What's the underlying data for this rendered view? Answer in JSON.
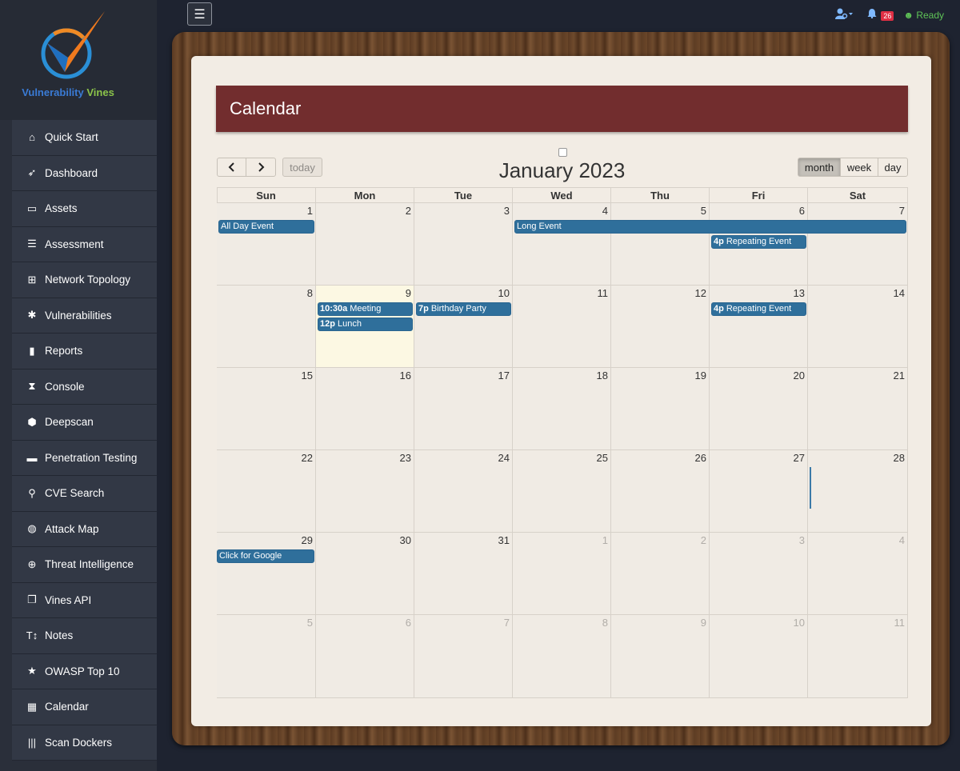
{
  "brand": {
    "name_part1": "Vulnerability",
    "name_part2": "Vines"
  },
  "sidebar": {
    "items": [
      {
        "label": "Quick Start",
        "icon": "home-icon",
        "glyph": "⌂"
      },
      {
        "label": "Dashboard",
        "icon": "rocket-icon",
        "glyph": "➶"
      },
      {
        "label": "Assets",
        "icon": "laptop-icon",
        "glyph": "▭"
      },
      {
        "label": "Assessment",
        "icon": "list-icon",
        "glyph": "☰"
      },
      {
        "label": "Network Topology",
        "icon": "sitemap-icon",
        "glyph": "⊞"
      },
      {
        "label": "Vulnerabilities",
        "icon": "bug-icon",
        "glyph": "✱"
      },
      {
        "label": "Reports",
        "icon": "file-icon",
        "glyph": "▮"
      },
      {
        "label": "Console",
        "icon": "hourglass-icon",
        "glyph": "⧗"
      },
      {
        "label": "Deepscan",
        "icon": "cube-icon",
        "glyph": "⬢"
      },
      {
        "label": "Penetration Testing",
        "icon": "hdd-icon",
        "glyph": "▬"
      },
      {
        "label": "CVE Search",
        "icon": "search-icon",
        "glyph": "⚲"
      },
      {
        "label": "Attack Map",
        "icon": "globe-icon",
        "glyph": "◍"
      },
      {
        "label": "Threat Intelligence",
        "icon": "crosshairs-icon",
        "glyph": "⊕"
      },
      {
        "label": "Vines API",
        "icon": "clone-icon",
        "glyph": "❐"
      },
      {
        "label": "Notes",
        "icon": "text-height-icon",
        "glyph": "T↕"
      },
      {
        "label": "OWASP Top 10",
        "icon": "star-icon",
        "glyph": "★"
      },
      {
        "label": "Calendar",
        "icon": "calendar-icon",
        "glyph": "▦"
      },
      {
        "label": "Scan Dockers",
        "icon": "barcode-icon",
        "glyph": "|||"
      }
    ]
  },
  "topbar": {
    "menu_icon": "☰",
    "notification_count": "26",
    "status": "Ready"
  },
  "page": {
    "title": "Calendar"
  },
  "calendar": {
    "title": "January 2023",
    "today_label": "today",
    "prev": "‹",
    "next": "›",
    "views": [
      "month",
      "week",
      "day"
    ],
    "active_view": "month",
    "weekdays": [
      "Sun",
      "Mon",
      "Tue",
      "Wed",
      "Thu",
      "Fri",
      "Sat"
    ],
    "weeks": [
      [
        "1",
        "2",
        "3",
        "4",
        "5",
        "6",
        "7"
      ],
      [
        "8",
        "9",
        "10",
        "11",
        "12",
        "13",
        "14"
      ],
      [
        "15",
        "16",
        "17",
        "18",
        "19",
        "20",
        "21"
      ],
      [
        "22",
        "23",
        "24",
        "25",
        "26",
        "27",
        "28"
      ],
      [
        "29",
        "30",
        "31",
        "1",
        "2",
        "3",
        "4"
      ],
      [
        "5",
        "6",
        "7",
        "8",
        "9",
        "10",
        "11"
      ]
    ],
    "today": {
      "week": 1,
      "day": 1
    },
    "events": [
      {
        "title": "All Day Event",
        "time": "",
        "week": 0,
        "day": 0,
        "span": 1,
        "slot": 0
      },
      {
        "title": "Long Event",
        "time": "",
        "week": 0,
        "day": 3,
        "span": 4,
        "slot": 0
      },
      {
        "title": "Repeating Event",
        "time": "4p",
        "week": 0,
        "day": 5,
        "span": 1,
        "slot": 1
      },
      {
        "title": "Meeting",
        "time": "10:30a",
        "week": 1,
        "day": 1,
        "span": 1,
        "slot": 0
      },
      {
        "title": "Lunch",
        "time": "12p",
        "week": 1,
        "day": 1,
        "span": 1,
        "slot": 1
      },
      {
        "title": "Birthday Party",
        "time": "7p",
        "week": 1,
        "day": 2,
        "span": 1,
        "slot": 0
      },
      {
        "title": "Repeating Event",
        "time": "4p",
        "week": 1,
        "day": 5,
        "span": 1,
        "slot": 0
      },
      {
        "title": "Click for Google",
        "time": "",
        "week": 4,
        "day": 0,
        "span": 1,
        "slot": 0
      }
    ]
  }
}
